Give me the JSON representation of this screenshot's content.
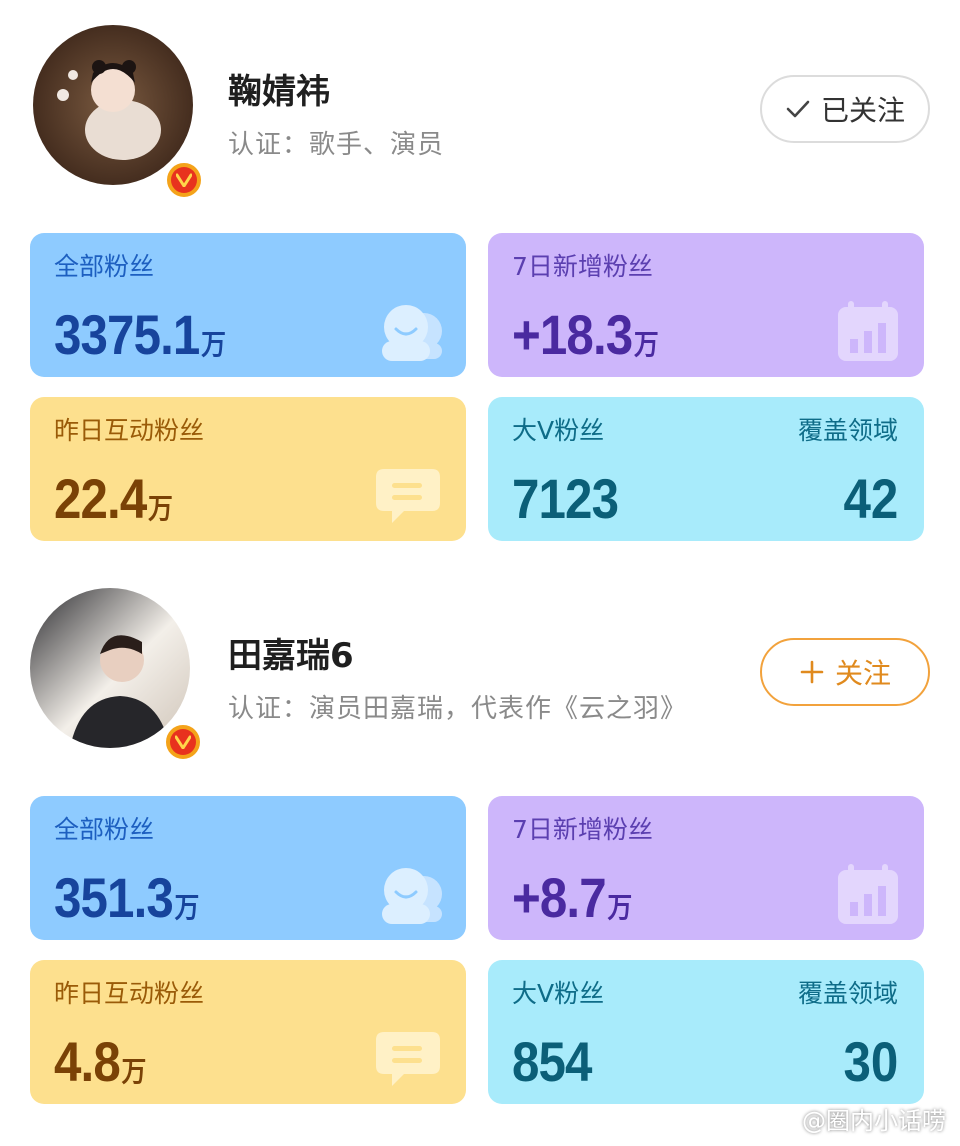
{
  "profiles": [
    {
      "name": "鞠婧祎",
      "cert": "认证：歌手、演员",
      "follow_label": "已关注",
      "follow_state": "followed",
      "stats": {
        "total_fans_label": "全部粉丝",
        "total_fans_value": "3375.1",
        "total_fans_unit": "万",
        "new_fans_label": "7日新增粉丝",
        "new_fans_value": "+18.3",
        "new_fans_unit": "万",
        "interact_label": "昨日互动粉丝",
        "interact_value": "22.4",
        "interact_unit": "万",
        "bigv_label": "大V粉丝",
        "bigv_value": "7123",
        "domain_label": "覆盖领域",
        "domain_value": "42"
      }
    },
    {
      "name": "田嘉瑞6",
      "cert": "认证：演员田嘉瑞，代表作《云之羽》",
      "follow_label": "关注",
      "follow_state": "unfollowed",
      "stats": {
        "total_fans_label": "全部粉丝",
        "total_fans_value": "351.3",
        "total_fans_unit": "万",
        "new_fans_label": "7日新增粉丝",
        "new_fans_value": "+8.7",
        "new_fans_unit": "万",
        "interact_label": "昨日互动粉丝",
        "interact_value": "4.8",
        "interact_unit": "万",
        "bigv_label": "大V粉丝",
        "bigv_value": "854",
        "domain_label": "覆盖领域",
        "domain_value": "30"
      }
    }
  ],
  "watermark": "@圈内小话唠",
  "icons": {
    "verified": "verified-v-badge-icon",
    "followed": "checkmark-icon",
    "follow": "plus-icon",
    "fans": "people-smile-icon",
    "new_fans": "calendar-chart-icon",
    "interact": "chat-bubble-icon",
    "watermark": "weibo-logo-icon"
  },
  "colors": {
    "blue_card": "#8ecbff",
    "purple_card": "#cdb6fb",
    "yellow_card": "#fde08e",
    "cyan_card": "#a8ebfb",
    "follow_accent": "#f2a23c",
    "verified_badge": "#f4a31a"
  }
}
